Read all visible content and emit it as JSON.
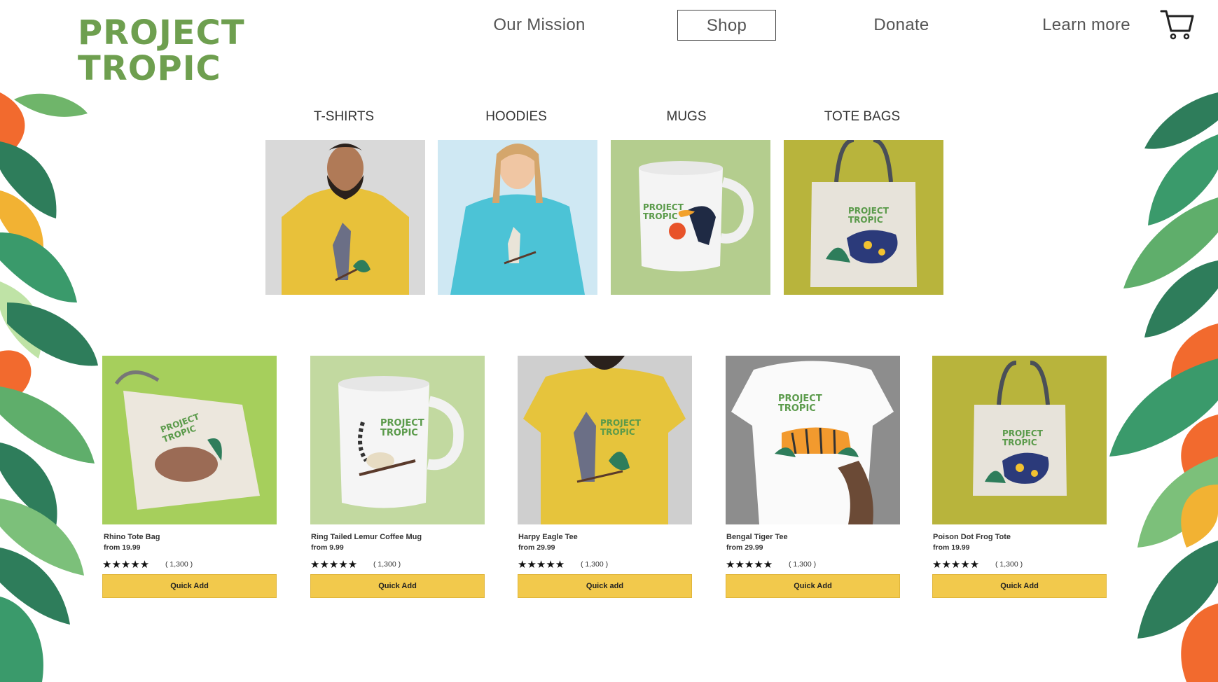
{
  "brand": {
    "line1": "PROJECT",
    "line2": "TROPIC",
    "color": "#6e9f4f"
  },
  "nav": {
    "mission": "Our Mission",
    "shop": "Shop",
    "donate": "Donate",
    "learn": "Learn more"
  },
  "categories": [
    {
      "label": "T-SHIRTS",
      "image": "man in yellow t-shirt with lemur print"
    },
    {
      "label": "HOODIES",
      "image": "woman in turquoise hoodie with lemur print"
    },
    {
      "label": "MUGS",
      "image": "white mug with toucan print"
    },
    {
      "label": "TOTE BAGS",
      "image": "tote bag with poison dart frog print"
    }
  ],
  "products": [
    {
      "name": "Rhino Tote Bag",
      "price": "from 19.99",
      "stars": "★★★★★",
      "count": "( 1,300 )",
      "button": "Quick Add"
    },
    {
      "name": "Ring Tailed Lemur Coffee Mug",
      "price": "from 9.99",
      "stars": "★★★★★",
      "count": "( 1,300 )",
      "button": "Quick Add"
    },
    {
      "name": "Harpy Eagle Tee",
      "price": "from 29.99",
      "stars": "★★★★★",
      "count": "( 1,300 )",
      "button": "Quick add"
    },
    {
      "name": "Bengal Tiger Tee",
      "price": "from 29.99",
      "stars": "★★★★★",
      "count": "( 1,300 )",
      "button": "Quick Add"
    },
    {
      "name": "Poison Dot Frog Tote",
      "price": "from 19.99",
      "stars": "★★★★★",
      "count": "( 1,300 )",
      "button": "Quick Add"
    }
  ],
  "print_text": {
    "line1": "PROJECT",
    "line2": "TROPIC"
  },
  "colors": {
    "accent_button": "#f2c94c",
    "logo_green": "#6e9f4f",
    "leaf_dark": "#2e7d5b",
    "leaf_light": "#5fae6b",
    "flower": "#f26a2e"
  },
  "icons": {
    "cart": "cart-icon",
    "star": "star-icon"
  }
}
